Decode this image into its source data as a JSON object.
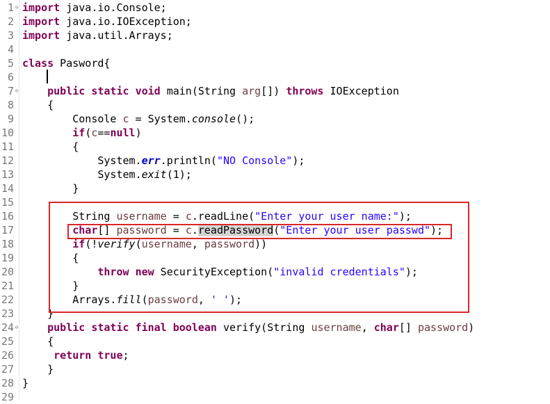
{
  "editor": {
    "lines": [
      {
        "num": "1",
        "fold": "⊖",
        "indent": "",
        "tokens": [
          {
            "t": "import",
            "c": "kw"
          },
          {
            "t": " java.io.Console;"
          }
        ]
      },
      {
        "num": "2",
        "fold": "",
        "indent": "",
        "tokens": [
          {
            "t": "import",
            "c": "kw"
          },
          {
            "t": " java.io.IOException;"
          }
        ]
      },
      {
        "num": "3",
        "fold": "",
        "indent": "",
        "tokens": [
          {
            "t": "import",
            "c": "kw"
          },
          {
            "t": " java.util.Arrays;"
          }
        ]
      },
      {
        "num": "4",
        "fold": "",
        "indent": "",
        "tokens": []
      },
      {
        "num": "5",
        "fold": "",
        "indent": "",
        "tokens": [
          {
            "t": "class",
            "c": "kw"
          },
          {
            "t": " Pasword{"
          }
        ]
      },
      {
        "num": "6",
        "fold": "",
        "indent": "",
        "tokens": []
      },
      {
        "num": "7",
        "fold": "⊖",
        "indent": "    ",
        "tokens": [
          {
            "t": "public",
            "c": "kw"
          },
          {
            "t": " "
          },
          {
            "t": "static",
            "c": "kw"
          },
          {
            "t": " "
          },
          {
            "t": "void",
            "c": "kw"
          },
          {
            "t": " main(String "
          },
          {
            "t": "arg",
            "c": "var"
          },
          {
            "t": "[]) "
          },
          {
            "t": "throws",
            "c": "kw"
          },
          {
            "t": " IOException"
          }
        ]
      },
      {
        "num": "8",
        "fold": "",
        "indent": "    ",
        "tokens": [
          {
            "t": "{"
          }
        ]
      },
      {
        "num": "9",
        "fold": "",
        "indent": "        ",
        "tokens": [
          {
            "t": "Console "
          },
          {
            "t": "c",
            "c": "var"
          },
          {
            "t": " = System."
          },
          {
            "t": "console",
            "c": "ital"
          },
          {
            "t": "();"
          }
        ]
      },
      {
        "num": "10",
        "fold": "",
        "indent": "        ",
        "tokens": [
          {
            "t": "if",
            "c": "kw"
          },
          {
            "t": "("
          },
          {
            "t": "c",
            "c": "var"
          },
          {
            "t": "=="
          },
          {
            "t": "null",
            "c": "kw"
          },
          {
            "t": ")"
          }
        ]
      },
      {
        "num": "11",
        "fold": "",
        "indent": "        ",
        "tokens": [
          {
            "t": "{"
          }
        ]
      },
      {
        "num": "12",
        "fold": "",
        "indent": "            ",
        "tokens": [
          {
            "t": "System."
          },
          {
            "t": "err",
            "c": "fld"
          },
          {
            "t": ".println("
          },
          {
            "t": "\"NO Console\"",
            "c": "str"
          },
          {
            "t": ");"
          }
        ]
      },
      {
        "num": "13",
        "fold": "",
        "indent": "            ",
        "tokens": [
          {
            "t": "System."
          },
          {
            "t": "exit",
            "c": "ital"
          },
          {
            "t": "(1);"
          }
        ]
      },
      {
        "num": "14",
        "fold": "",
        "indent": "        ",
        "tokens": [
          {
            "t": "}"
          }
        ]
      },
      {
        "num": "15",
        "fold": "",
        "indent": "",
        "tokens": []
      },
      {
        "num": "16",
        "fold": "",
        "indent": "        ",
        "tokens": [
          {
            "t": "String "
          },
          {
            "t": "username",
            "c": "var"
          },
          {
            "t": " = "
          },
          {
            "t": "c",
            "c": "var"
          },
          {
            "t": ".readLine("
          },
          {
            "t": "\"Enter your user name:\"",
            "c": "str"
          },
          {
            "t": ");"
          }
        ]
      },
      {
        "num": "17",
        "fold": "",
        "indent": "        ",
        "tokens": [
          {
            "t": "char",
            "c": "kw"
          },
          {
            "t": "[] "
          },
          {
            "t": "password",
            "c": "var"
          },
          {
            "t": " = "
          },
          {
            "t": "c",
            "c": "var"
          },
          {
            "t": "."
          },
          {
            "t": "readPassword",
            "c": "hl"
          },
          {
            "t": "("
          },
          {
            "t": "\"Enter your user passwd\"",
            "c": "str"
          },
          {
            "t": ");"
          }
        ]
      },
      {
        "num": "18",
        "fold": "",
        "indent": "        ",
        "tokens": [
          {
            "t": "if",
            "c": "kw"
          },
          {
            "t": "(!"
          },
          {
            "t": "verify",
            "c": "ital"
          },
          {
            "t": "("
          },
          {
            "t": "username",
            "c": "var"
          },
          {
            "t": ", "
          },
          {
            "t": "password",
            "c": "var"
          },
          {
            "t": "))"
          }
        ]
      },
      {
        "num": "19",
        "fold": "",
        "indent": "        ",
        "tokens": [
          {
            "t": "{"
          }
        ]
      },
      {
        "num": "20",
        "fold": "",
        "indent": "            ",
        "tokens": [
          {
            "t": "throw",
            "c": "kw"
          },
          {
            "t": " "
          },
          {
            "t": "new",
            "c": "kw"
          },
          {
            "t": " SecurityException("
          },
          {
            "t": "\"invalid credentials\"",
            "c": "str"
          },
          {
            "t": ");"
          }
        ]
      },
      {
        "num": "21",
        "fold": "",
        "indent": "        ",
        "tokens": [
          {
            "t": "}"
          }
        ]
      },
      {
        "num": "22",
        "fold": "",
        "indent": "        ",
        "tokens": [
          {
            "t": "Arrays."
          },
          {
            "t": "fill",
            "c": "ital"
          },
          {
            "t": "("
          },
          {
            "t": "password",
            "c": "var"
          },
          {
            "t": ", "
          },
          {
            "t": "' '",
            "c": "str"
          },
          {
            "t": ");"
          }
        ]
      },
      {
        "num": "23",
        "fold": "",
        "indent": "    ",
        "tokens": [
          {
            "t": "}"
          }
        ]
      },
      {
        "num": "24",
        "fold": "⊖",
        "indent": "    ",
        "tokens": [
          {
            "t": "public",
            "c": "kw"
          },
          {
            "t": " "
          },
          {
            "t": "static",
            "c": "kw"
          },
          {
            "t": " "
          },
          {
            "t": "final",
            "c": "kw"
          },
          {
            "t": " "
          },
          {
            "t": "boolean",
            "c": "kw"
          },
          {
            "t": " verify(String "
          },
          {
            "t": "username",
            "c": "var"
          },
          {
            "t": ", "
          },
          {
            "t": "char",
            "c": "kw"
          },
          {
            "t": "[] "
          },
          {
            "t": "password",
            "c": "var"
          },
          {
            "t": ")"
          }
        ]
      },
      {
        "num": "25",
        "fold": "",
        "indent": "    ",
        "tokens": [
          {
            "t": "{"
          }
        ]
      },
      {
        "num": "26",
        "fold": "",
        "indent": "     ",
        "tokens": [
          {
            "t": "return",
            "c": "kw"
          },
          {
            "t": " "
          },
          {
            "t": "true",
            "c": "kw"
          },
          {
            "t": ";"
          }
        ]
      },
      {
        "num": "27",
        "fold": "",
        "indent": "    ",
        "tokens": [
          {
            "t": "}"
          }
        ]
      },
      {
        "num": "28",
        "fold": "",
        "indent": "",
        "tokens": [
          {
            "t": "}"
          }
        ]
      },
      {
        "num": "29",
        "fold": "",
        "indent": "",
        "tokens": []
      }
    ],
    "colors": {
      "keyword": "#7f0055",
      "string": "#2a00ff",
      "variable": "#6a3e3e",
      "field": "#0000c0",
      "highlight": "#d4d4d4",
      "annotation_box": "#d92626"
    }
  }
}
